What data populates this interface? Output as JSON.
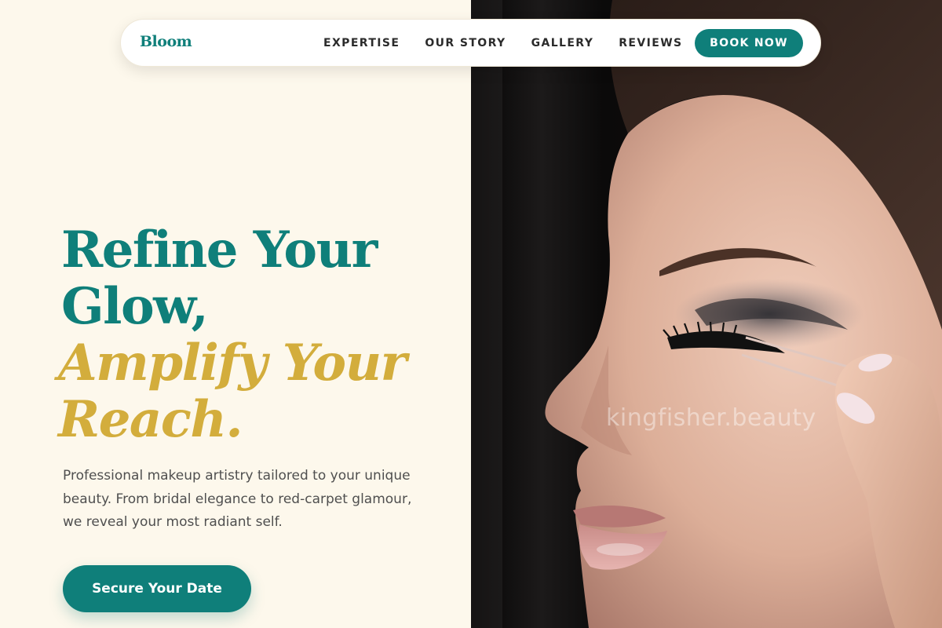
{
  "navbar": {
    "brand": "Bloom",
    "links": [
      {
        "label": "EXPERTISE"
      },
      {
        "label": "OUR STORY"
      },
      {
        "label": "GALLERY"
      },
      {
        "label": "REVIEWS"
      }
    ],
    "cta_label": "BOOK NOW"
  },
  "hero": {
    "headline_primary": "Refine Your Glow,",
    "headline_accent": "Amplify Your Reach.",
    "subtitle": "Professional makeup artistry tailored to your unique beauty. From bridal elegance to red-carpet glamour, we reveal your most radiant self.",
    "cta_label": "Secure Your Date",
    "image": {
      "subject": "woman-applying-false-eyelashes-with-tweezers",
      "watermark": "kingfisher.beauty"
    }
  },
  "colors": {
    "background": "#fdf8ec",
    "primary": "#0f7f7a",
    "accent": "#d3ad3c",
    "text": "#2b2b2b",
    "muted_text": "#4f4f4f"
  }
}
